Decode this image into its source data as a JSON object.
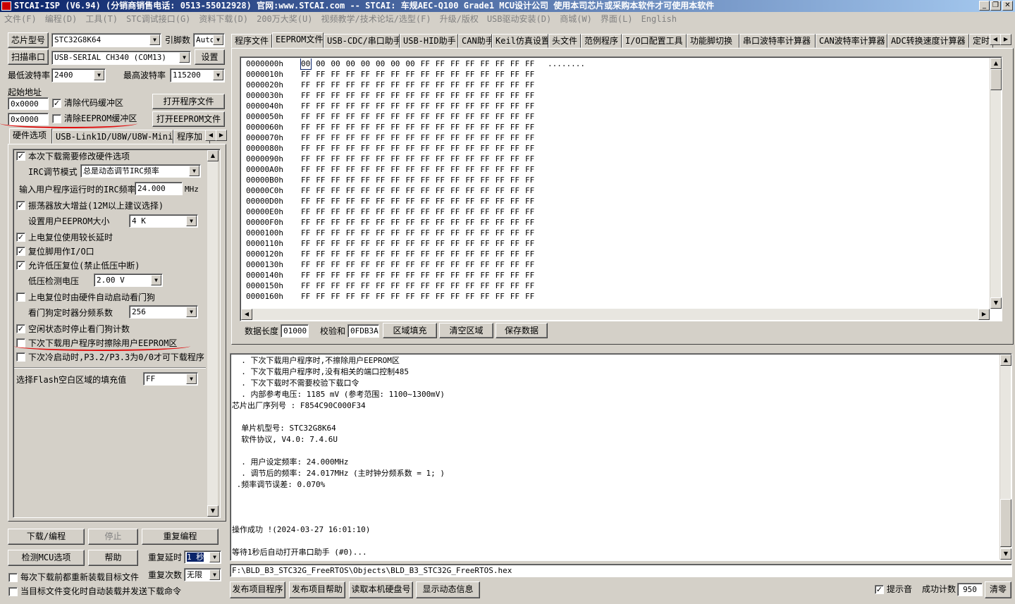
{
  "window": {
    "title": "STCAI-ISP (V6.94) (分销商销售电话: 0513-55012928) 官网:www.STCAI.com  -- STCAI: 车规AEC-Q100 Grade1 MCU设计公司  使用本司芯片或采购本软件才可使用本软件",
    "minimize": "_",
    "restore": "❐",
    "close": "✕"
  },
  "menu": [
    "文件(F)",
    "编程(D)",
    "工具(T)",
    "STC调试接口(G)",
    "资料下载(D)",
    "200万大奖(U)",
    "视频教学/技术论坛/选型(F)",
    "升级/版权",
    "USB驱动安装(D)",
    "商城(W)",
    "界面(L)",
    "English"
  ],
  "left": {
    "chip_model_btn": "芯片型号",
    "chip_model": "STC32G8K64",
    "pin_count_label": "引脚数",
    "pin_count": "Auto",
    "scan_port_btn": "扫描串口",
    "port": "USB-SERIAL CH340  (COM13)",
    "settings_btn": "设置",
    "min_baud_label": "最低波特率",
    "min_baud": "2400",
    "max_baud_label": "最高波特率",
    "max_baud": "115200",
    "start_addr_label": "起始地址",
    "code_addr": "0x0000",
    "clear_code_label": "清除代码缓冲区",
    "clear_code_checked": true,
    "open_program_btn": "打开程序文件",
    "eeprom_addr": "0x0000",
    "clear_eeprom_label": "清除EEPROM缓冲区",
    "clear_eeprom_checked": false,
    "open_eeprom_btn": "打开EEPROM文件",
    "tabs": [
      "硬件选项",
      "USB-Link1D/U8W/U8W-Mini脱机",
      "程序加"
    ],
    "options": {
      "modify_hw": "本次下载需要修改硬件选项",
      "irc_mode_label": "IRC调节模式",
      "irc_mode": "总是动态调节IRC频率",
      "irc_freq_label": "输入用户程序运行时的IRC频率",
      "irc_freq": "24.000",
      "irc_unit": "MHz",
      "osc_gain": "振荡器放大增益(12M以上建议选择)",
      "eeprom_size_label": "设置用户EEPROM大小",
      "eeprom_size": "4   K",
      "power_delay": "上电复位使用较长延时",
      "reset_pin_io": "复位脚用作I/O口",
      "low_volt_reset": "允许低压复位(禁止低压中断)",
      "low_volt_label": "低压检测电压",
      "low_volt": "2.00 V",
      "hw_watchdog": "上电复位时由硬件自动启动看门狗",
      "wdt_div_label": "看门狗定时器分频系数",
      "wdt_div": "256",
      "idle_stop_wdt": "空闲状态时停止看门狗计数",
      "erase_eeprom": "下次下载用户程序时擦除用户EEPROM区",
      "p32_p33": "下次冷启动时,P3.2/P3.3为0/0才可下载程序",
      "fill_label": "选择Flash空白区域的填充值",
      "fill_value": "FF"
    },
    "download_btn": "下载/编程",
    "stop_btn": "停止",
    "reprogram_btn": "重复编程",
    "check_mcu_btn": "检测MCU选项",
    "help_btn": "帮助",
    "repeat_delay_label": "重复延时",
    "repeat_delay": "1 秒",
    "repeat_count_label": "重复次数",
    "repeat_count": "无限",
    "reload_label": "每次下载前都重新装载目标文件",
    "auto_load_label": "当目标文件变化时自动装载并发送下载命令"
  },
  "right": {
    "tabs": [
      "程序文件",
      "EEPROM文件",
      "USB-CDC/串口助手",
      "USB-HID助手",
      "CAN助手",
      "Keil仿真设置",
      "头文件",
      "范例程序",
      "I/O口配置工具",
      "功能脚切换",
      "串口波特率计算器",
      "CAN波特率计算器",
      "ADC转换速度计算器",
      "定时"
    ],
    "hex_rows": [
      {
        "addr": "0000000h",
        "bytes": [
          "00",
          "00",
          "00",
          "00",
          "00",
          "00",
          "00",
          "00",
          "FF",
          "FF",
          "FF",
          "FF",
          "FF",
          "FF",
          "FF",
          "FF"
        ],
        "ascii": "........"
      },
      {
        "addr": "0000010h",
        "bytes": [
          "FF",
          "FF",
          "FF",
          "FF",
          "FF",
          "FF",
          "FF",
          "FF",
          "FF",
          "FF",
          "FF",
          "FF",
          "FF",
          "FF",
          "FF",
          "FF"
        ],
        "ascii": ""
      },
      {
        "addr": "0000020h",
        "bytes": [
          "FF",
          "FF",
          "FF",
          "FF",
          "FF",
          "FF",
          "FF",
          "FF",
          "FF",
          "FF",
          "FF",
          "FF",
          "FF",
          "FF",
          "FF",
          "FF"
        ],
        "ascii": ""
      },
      {
        "addr": "0000030h",
        "bytes": [
          "FF",
          "FF",
          "FF",
          "FF",
          "FF",
          "FF",
          "FF",
          "FF",
          "FF",
          "FF",
          "FF",
          "FF",
          "FF",
          "FF",
          "FF",
          "FF"
        ],
        "ascii": ""
      },
      {
        "addr": "0000040h",
        "bytes": [
          "FF",
          "FF",
          "FF",
          "FF",
          "FF",
          "FF",
          "FF",
          "FF",
          "FF",
          "FF",
          "FF",
          "FF",
          "FF",
          "FF",
          "FF",
          "FF"
        ],
        "ascii": ""
      },
      {
        "addr": "0000050h",
        "bytes": [
          "FF",
          "FF",
          "FF",
          "FF",
          "FF",
          "FF",
          "FF",
          "FF",
          "FF",
          "FF",
          "FF",
          "FF",
          "FF",
          "FF",
          "FF",
          "FF"
        ],
        "ascii": ""
      },
      {
        "addr": "0000060h",
        "bytes": [
          "FF",
          "FF",
          "FF",
          "FF",
          "FF",
          "FF",
          "FF",
          "FF",
          "FF",
          "FF",
          "FF",
          "FF",
          "FF",
          "FF",
          "FF",
          "FF"
        ],
        "ascii": ""
      },
      {
        "addr": "0000070h",
        "bytes": [
          "FF",
          "FF",
          "FF",
          "FF",
          "FF",
          "FF",
          "FF",
          "FF",
          "FF",
          "FF",
          "FF",
          "FF",
          "FF",
          "FF",
          "FF",
          "FF"
        ],
        "ascii": ""
      },
      {
        "addr": "0000080h",
        "bytes": [
          "FF",
          "FF",
          "FF",
          "FF",
          "FF",
          "FF",
          "FF",
          "FF",
          "FF",
          "FF",
          "FF",
          "FF",
          "FF",
          "FF",
          "FF",
          "FF"
        ],
        "ascii": ""
      },
      {
        "addr": "0000090h",
        "bytes": [
          "FF",
          "FF",
          "FF",
          "FF",
          "FF",
          "FF",
          "FF",
          "FF",
          "FF",
          "FF",
          "FF",
          "FF",
          "FF",
          "FF",
          "FF",
          "FF"
        ],
        "ascii": ""
      },
      {
        "addr": "00000A0h",
        "bytes": [
          "FF",
          "FF",
          "FF",
          "FF",
          "FF",
          "FF",
          "FF",
          "FF",
          "FF",
          "FF",
          "FF",
          "FF",
          "FF",
          "FF",
          "FF",
          "FF"
        ],
        "ascii": ""
      },
      {
        "addr": "00000B0h",
        "bytes": [
          "FF",
          "FF",
          "FF",
          "FF",
          "FF",
          "FF",
          "FF",
          "FF",
          "FF",
          "FF",
          "FF",
          "FF",
          "FF",
          "FF",
          "FF",
          "FF"
        ],
        "ascii": ""
      },
      {
        "addr": "00000C0h",
        "bytes": [
          "FF",
          "FF",
          "FF",
          "FF",
          "FF",
          "FF",
          "FF",
          "FF",
          "FF",
          "FF",
          "FF",
          "FF",
          "FF",
          "FF",
          "FF",
          "FF"
        ],
        "ascii": ""
      },
      {
        "addr": "00000D0h",
        "bytes": [
          "FF",
          "FF",
          "FF",
          "FF",
          "FF",
          "FF",
          "FF",
          "FF",
          "FF",
          "FF",
          "FF",
          "FF",
          "FF",
          "FF",
          "FF",
          "FF"
        ],
        "ascii": ""
      },
      {
        "addr": "00000E0h",
        "bytes": [
          "FF",
          "FF",
          "FF",
          "FF",
          "FF",
          "FF",
          "FF",
          "FF",
          "FF",
          "FF",
          "FF",
          "FF",
          "FF",
          "FF",
          "FF",
          "FF"
        ],
        "ascii": ""
      },
      {
        "addr": "00000F0h",
        "bytes": [
          "FF",
          "FF",
          "FF",
          "FF",
          "FF",
          "FF",
          "FF",
          "FF",
          "FF",
          "FF",
          "FF",
          "FF",
          "FF",
          "FF",
          "FF",
          "FF"
        ],
        "ascii": ""
      },
      {
        "addr": "0000100h",
        "bytes": [
          "FF",
          "FF",
          "FF",
          "FF",
          "FF",
          "FF",
          "FF",
          "FF",
          "FF",
          "FF",
          "FF",
          "FF",
          "FF",
          "FF",
          "FF",
          "FF"
        ],
        "ascii": ""
      },
      {
        "addr": "0000110h",
        "bytes": [
          "FF",
          "FF",
          "FF",
          "FF",
          "FF",
          "FF",
          "FF",
          "FF",
          "FF",
          "FF",
          "FF",
          "FF",
          "FF",
          "FF",
          "FF",
          "FF"
        ],
        "ascii": ""
      },
      {
        "addr": "0000120h",
        "bytes": [
          "FF",
          "FF",
          "FF",
          "FF",
          "FF",
          "FF",
          "FF",
          "FF",
          "FF",
          "FF",
          "FF",
          "FF",
          "FF",
          "FF",
          "FF",
          "FF"
        ],
        "ascii": ""
      },
      {
        "addr": "0000130h",
        "bytes": [
          "FF",
          "FF",
          "FF",
          "FF",
          "FF",
          "FF",
          "FF",
          "FF",
          "FF",
          "FF",
          "FF",
          "FF",
          "FF",
          "FF",
          "FF",
          "FF"
        ],
        "ascii": ""
      },
      {
        "addr": "0000140h",
        "bytes": [
          "FF",
          "FF",
          "FF",
          "FF",
          "FF",
          "FF",
          "FF",
          "FF",
          "FF",
          "FF",
          "FF",
          "FF",
          "FF",
          "FF",
          "FF",
          "FF"
        ],
        "ascii": ""
      },
      {
        "addr": "0000150h",
        "bytes": [
          "FF",
          "FF",
          "FF",
          "FF",
          "FF",
          "FF",
          "FF",
          "FF",
          "FF",
          "FF",
          "FF",
          "FF",
          "FF",
          "FF",
          "FF",
          "FF"
        ],
        "ascii": ""
      },
      {
        "addr": "0000160h",
        "bytes": [
          "FF",
          "FF",
          "FF",
          "FF",
          "FF",
          "FF",
          "FF",
          "FF",
          "FF",
          "FF",
          "FF",
          "FF",
          "FF",
          "FF",
          "FF",
          "FF"
        ],
        "ascii": ""
      }
    ],
    "data_len_label": "数据长度",
    "data_len": "01000",
    "checksum_label": "校验和",
    "checksum": "0FDB3A",
    "fill_area_btn": "区域填充",
    "clear_area_btn": "清空区域",
    "save_data_btn": "保存数据",
    "log_lines": [
      "  . 下次下载用户程序时,不擦除用户EEPROM区",
      "  . 下次下载用户程序时,没有相关的端口控制485",
      "  . 下次下载时不需要校验下载口令",
      "  . 内部参考电压: 1185 mV (参考范围: 1100~1300mV)",
      "芯片出厂序列号 : F854C90C000F34",
      "",
      "  单片机型号: STC32G8K64",
      "  软件协议, V4.0: 7.4.6U",
      "",
      "  . 用户设定频率: 24.000MHz",
      "  . 调节后的频率: 24.017MHz (主时钟分频系数 = 1; )",
      " .频率调节误差: 0.070%",
      "",
      "",
      "",
      "操作成功 !(2024-03-27 16:01:10)",
      "",
      "等待1秒后自动打开串口助手 (#0)..."
    ],
    "file_path": "F:\\BLD_B3_STC32G_FreeRTOS\\Objects\\BLD_B3_STC32G_FreeRTOS.hex",
    "publish_btn": "发布项目程序",
    "publish_help_btn": "发布项目帮助",
    "read_disk_btn": "读取本机硬盘号",
    "show_info_btn": "显示动态信息",
    "sound_label": "提示音",
    "sound_checked": true,
    "success_label": "成功计数",
    "success_count": "950",
    "clear_btn": "清零"
  },
  "colors": {
    "annotation": "#e01010",
    "title_bar": "#0a246a"
  }
}
